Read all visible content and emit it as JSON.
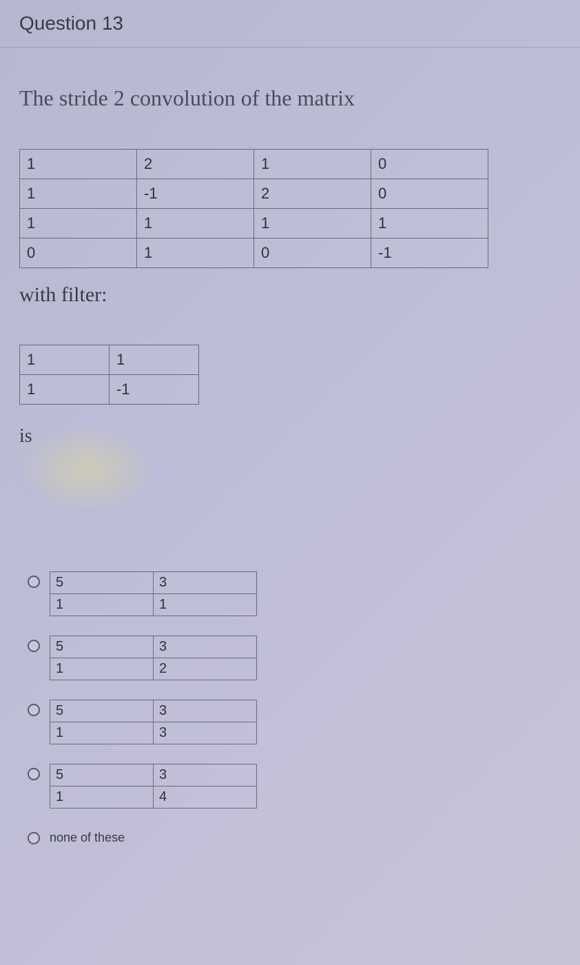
{
  "header": {
    "title": "Question 13"
  },
  "prompt": "The stride 2 convolution of the matrix",
  "matrix": [
    [
      "1",
      "2",
      "1",
      "0"
    ],
    [
      "1",
      "-1",
      "2",
      "0"
    ],
    [
      "1",
      "1",
      "1",
      "1"
    ],
    [
      "0",
      "1",
      "0",
      "-1"
    ]
  ],
  "with_filter_label": "with filter:",
  "filter": [
    [
      "1",
      "1"
    ],
    [
      "1",
      "-1"
    ]
  ],
  "is_label": "is",
  "options": [
    {
      "type": "table",
      "rows": [
        [
          "5",
          "3"
        ],
        [
          "1",
          "1"
        ]
      ]
    },
    {
      "type": "table",
      "rows": [
        [
          "5",
          "3"
        ],
        [
          "1",
          "2"
        ]
      ]
    },
    {
      "type": "table",
      "rows": [
        [
          "5",
          "3"
        ],
        [
          "1",
          "3"
        ]
      ]
    },
    {
      "type": "table",
      "rows": [
        [
          "5",
          "3"
        ],
        [
          "1",
          "4"
        ]
      ]
    },
    {
      "type": "text",
      "label": "none of these"
    }
  ]
}
